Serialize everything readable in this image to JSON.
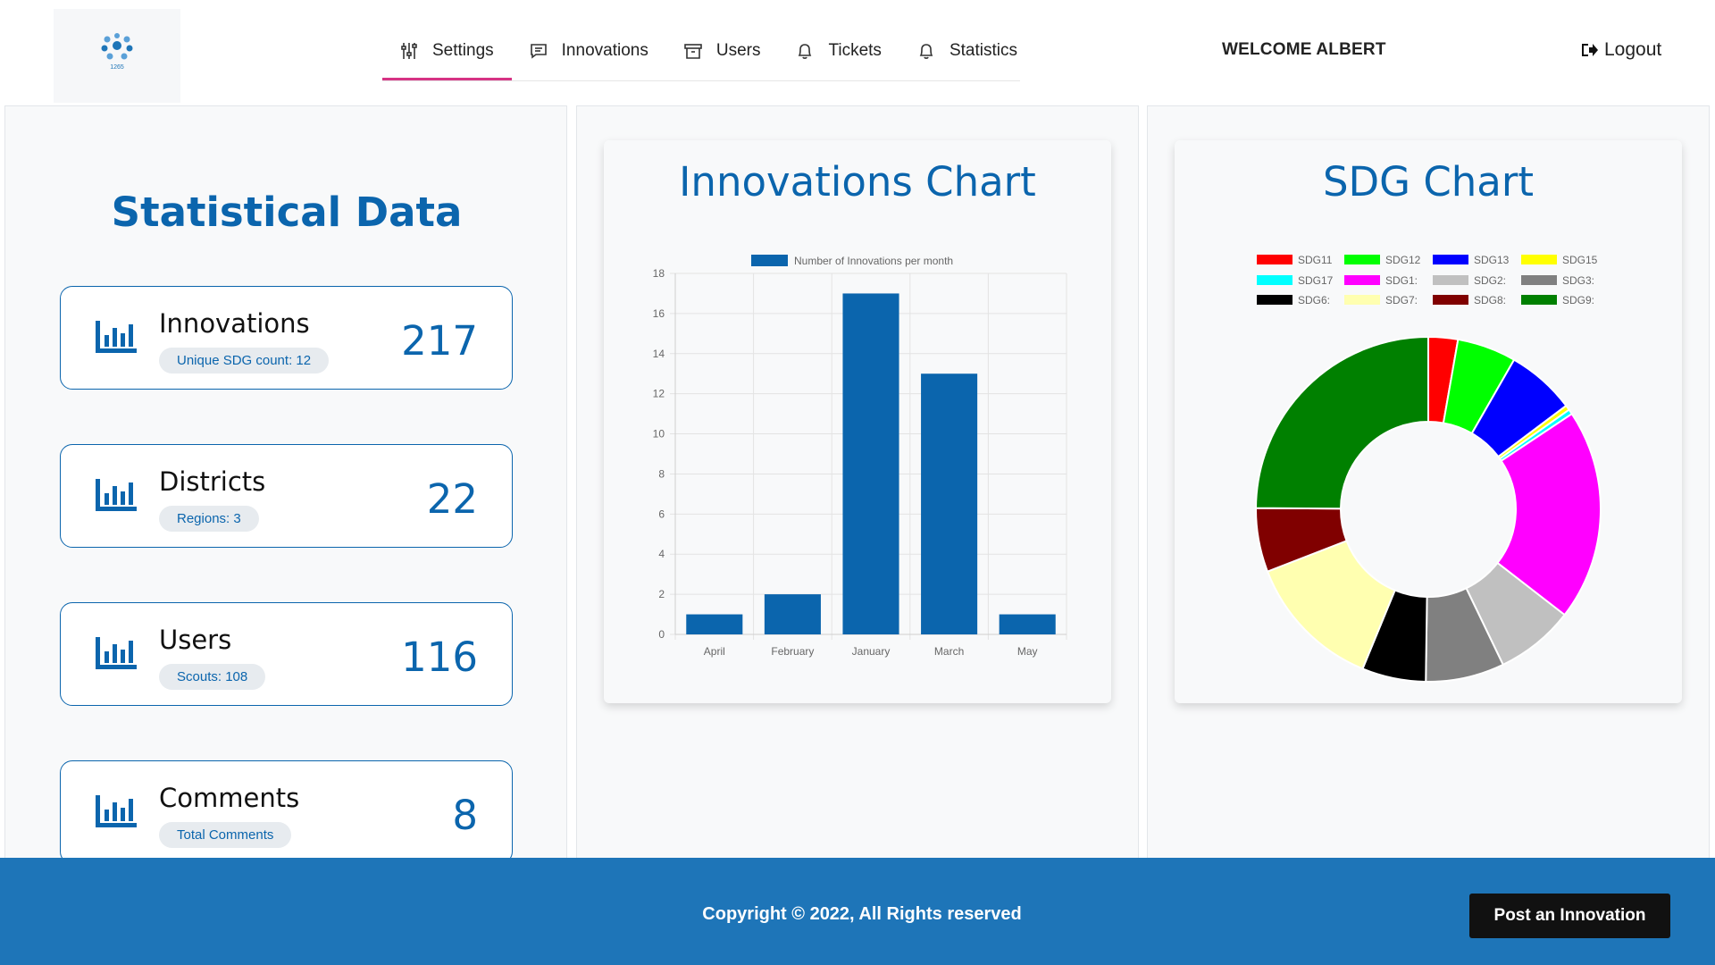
{
  "header": {
    "logo_text": "1265",
    "nav": [
      {
        "label": "Settings",
        "icon": "sliders-icon",
        "active": true
      },
      {
        "label": "Innovations",
        "icon": "message-icon"
      },
      {
        "label": "Users",
        "icon": "archive-icon"
      },
      {
        "label": "Tickets",
        "icon": "bell-icon"
      },
      {
        "label": "Statistics",
        "icon": "bell-icon"
      }
    ],
    "welcome": "WELCOME ALBERT",
    "logout": "Logout"
  },
  "statistics": {
    "title": "Statistical Data",
    "cards": [
      {
        "label": "Innovations",
        "sub": "Unique SDG count: 12",
        "value": "217"
      },
      {
        "label": "Districts",
        "sub": "Regions: 3",
        "value": "22"
      },
      {
        "label": "Users",
        "sub": "Scouts: 108",
        "value": "116"
      },
      {
        "label": "Comments",
        "sub": "Total Comments",
        "value": "8"
      }
    ]
  },
  "innovations_chart": {
    "title": "Innovations Chart"
  },
  "sdg_chart": {
    "title": "SDG Chart"
  },
  "chart_data": [
    {
      "type": "bar",
      "title": "Innovations Chart",
      "legend": "Number of Innovations per month",
      "categories": [
        "April",
        "February",
        "January",
        "March",
        "May"
      ],
      "values": [
        1,
        2,
        17,
        13,
        1
      ],
      "ylim": [
        0,
        18
      ],
      "yticks": [
        0,
        2,
        4,
        6,
        8,
        10,
        12,
        14,
        16,
        18
      ],
      "color": "#0b65ad",
      "grid": true,
      "legend_position": "top"
    },
    {
      "type": "pie",
      "variant": "doughnut",
      "title": "SDG Chart",
      "legend_position": "top",
      "labels": [
        "SDG11",
        "SDG12",
        "SDG13",
        "SDG15",
        "SDG17",
        "SDG1:",
        "SDG2:",
        "SDG3:",
        "SDG6:",
        "SDG7:",
        "SDG8:",
        "SDG9:"
      ],
      "values": [
        6,
        12,
        14,
        1,
        1,
        43,
        16,
        16,
        13,
        28,
        13,
        54
      ],
      "colors": [
        "#ff0000",
        "#00ff00",
        "#0000ff",
        "#ffff00",
        "#00ffff",
        "#ff00ff",
        "#c0c0c0",
        "#808080",
        "#000000",
        "#ffffb0",
        "#800000",
        "#008000"
      ]
    }
  ],
  "footer": {
    "copyright": "Copyright © 2022, All Rights reserved",
    "post_button": "Post an Innovation"
  }
}
